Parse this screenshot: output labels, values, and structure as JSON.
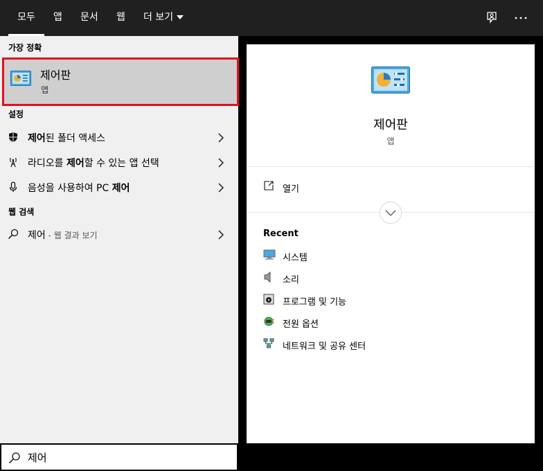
{
  "tabs": [
    {
      "label": "모두",
      "active": true
    },
    {
      "label": "앱"
    },
    {
      "label": "문서"
    },
    {
      "label": "웹"
    },
    {
      "label": "더 보기"
    }
  ],
  "top_icons": [
    "feedback-icon",
    "more-options-icon"
  ],
  "left": {
    "best_match_title": "가장 정확",
    "best_match": {
      "name": "제어판",
      "type": "앱",
      "icon": "control-panel-icon"
    },
    "settings_title": "설정",
    "settings": [
      {
        "pre": "",
        "bold": "제어",
        "post": "된 폴더 액세스",
        "icon": "shield-icon"
      },
      {
        "pre": "라디오를 ",
        "bold": "제어",
        "post": "할 수 있는 앱 선택",
        "icon": "antenna-icon"
      },
      {
        "pre": "음성을 사용하여 PC ",
        "bold": "제어",
        "post": "",
        "icon": "microphone-icon"
      }
    ],
    "web_title": "웹 검색",
    "web": {
      "query": "제어",
      "suffix": " - 웹 결과 보기",
      "icon": "search-icon"
    }
  },
  "right": {
    "name": "제어판",
    "type": "앱",
    "open_label": "열기",
    "recent_title": "Recent",
    "recent": [
      {
        "label": "시스템",
        "icon": "system-monitor-icon"
      },
      {
        "label": "소리",
        "icon": "speaker-icon"
      },
      {
        "label": "프로그램 및 기능",
        "icon": "programs-icon"
      },
      {
        "label": "전원 옵션",
        "icon": "power-options-icon"
      },
      {
        "label": "네트워크 및 공유 센터",
        "icon": "network-icon"
      }
    ]
  },
  "search": {
    "value": "제어"
  },
  "colors": {
    "topbar": "#202020",
    "highlight_border": "#e0111d",
    "selected_bg": "#cfcfcf",
    "panel_bg": "#f0f0f0"
  }
}
